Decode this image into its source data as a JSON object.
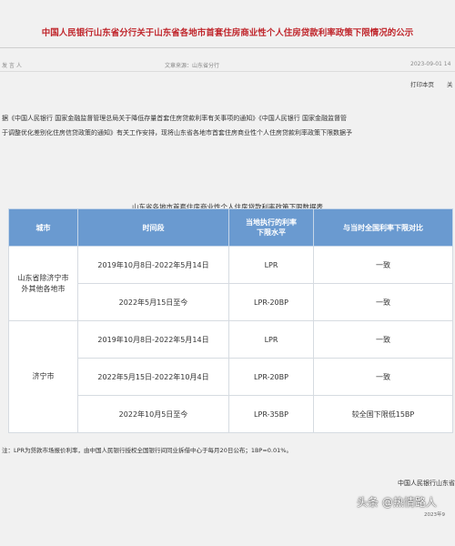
{
  "page": {
    "title": "中国人民银行山东省分行关于山东省各地市首套住房商业性个人住房贷款利率政策下限情况的公示",
    "meta_left": "发 言 人",
    "meta_source": "文章来源：山东省分行",
    "meta_date": "2023-09-01 14",
    "link_print": "打印本页",
    "link_close": "关"
  },
  "body": {
    "line1": "据《中国人民银行 国家金融监督管理总局关于降低存量首套住房贷款利率有关事项的通知》《中国人民银行 国家金融监督管",
    "line2": "于调整优化差别化住房信贷政策的通知》有关工作安排，现将山东省各地市首套住房商业性个人住房贷款利率政策下限数据予"
  },
  "table": {
    "caption": "山东省各地市首套住房商业性个人住房贷款利率政策下限数据表",
    "headers": {
      "city": "城市",
      "period": "时间段",
      "rate_line1": "当地执行的利率",
      "rate_line2": "下限水平",
      "compare": "与当时全国利率下限对比"
    },
    "rows": [
      {
        "city_line1": "山东省除济宁市",
        "city_line2": "外其他各地市",
        "entries": [
          {
            "period": "2019年10月8日-2022年5月14日",
            "rate": "LPR",
            "compare": "一致"
          },
          {
            "period": "2022年5月15日至今",
            "rate": "LPR-20BP",
            "compare": "一致"
          }
        ]
      },
      {
        "city_line1": "济宁市",
        "entries": [
          {
            "period": "2019年10月8日-2022年5月14日",
            "rate": "LPR",
            "compare": "一致"
          },
          {
            "period": "2022年5月15日-2022年10月4日",
            "rate": "LPR-20BP",
            "compare": "一致"
          },
          {
            "period": "2022年10月5日至今",
            "rate": "LPR-35BP",
            "compare": "较全国下限低15BP"
          }
        ]
      }
    ]
  },
  "note": "注：LPR为贷款市场报价利率，由中国人民银行授权全国银行间同业拆借中心于每月20日公布；1BP=0.01%。",
  "footer": {
    "signature": "中国人民银行山东省",
    "watermark": "头条 @热情路人",
    "date": "2023年9"
  }
}
